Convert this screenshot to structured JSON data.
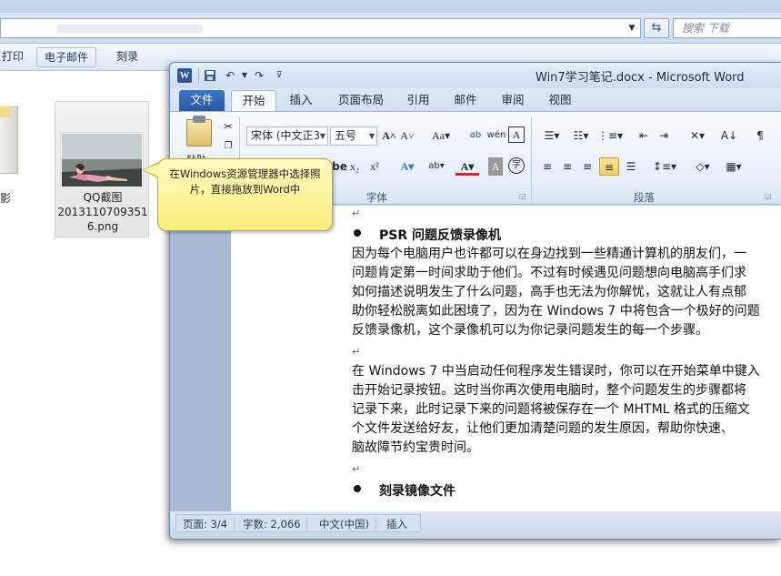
{
  "explorer": {
    "search_placeholder": "搜索 下载",
    "toolbar": {
      "print": "打印",
      "email": "电子邮件",
      "burn": "刻录"
    },
    "file_partial_label": "影",
    "file": {
      "name_line1": "QQ截图",
      "name_line2": "2013110709351",
      "name_line3": "6.png"
    }
  },
  "callout": {
    "text": "在Windows资源管理器中选择照片，直接拖放到Word中"
  },
  "word": {
    "title": "Win7学习笔记.docx - Microsoft Word",
    "tabs": [
      "文件",
      "开始",
      "插入",
      "页面布局",
      "引用",
      "邮件",
      "审阅",
      "视图"
    ],
    "ribbon": {
      "paste_label": "粘贴",
      "font_name": "宋体 (中文正3",
      "font_size": "五号",
      "group_font": "字体",
      "group_paragraph": "段落"
    },
    "document": {
      "heading1": "PSR 问题反馈录像机",
      "para1": [
        "因为每个电脑用户也许都可以在身边找到一些精通计算机的朋友们，一",
        "问题肯定第一时间求助于他们。不过有时候遇见问题想向电脑高手们求",
        "如何描述说明发生了什么问题，高手也无法为你解忧，这就让人有点郁",
        "助你轻松脱离如此困境了，因为在 Windows 7 中将包含一个极好的问题",
        "反馈录像机，这个录像机可以为你记录问题发生的每一个步骤。"
      ],
      "para2": [
        "在 Windows 7 中当启动任何程序发生错误时，你可以在开始菜单中键入",
        "击开始记录按钮。这时当你再次使用电脑时，整个问题发生的步骤都将",
        "记录下来，此时记录下来的问题将被保存在一个 MHTML 格式的压缩文",
        "个文件发送给好友，让他们更加清楚问题的发生原因，帮助你快速、",
        "脑故障节约宝贵时间。"
      ],
      "heading2": "刻录镜像文件"
    },
    "status": {
      "page": "页面: 3/4",
      "words": "字数: 2,066",
      "language": "中文(中国)",
      "insert": "插入"
    }
  }
}
